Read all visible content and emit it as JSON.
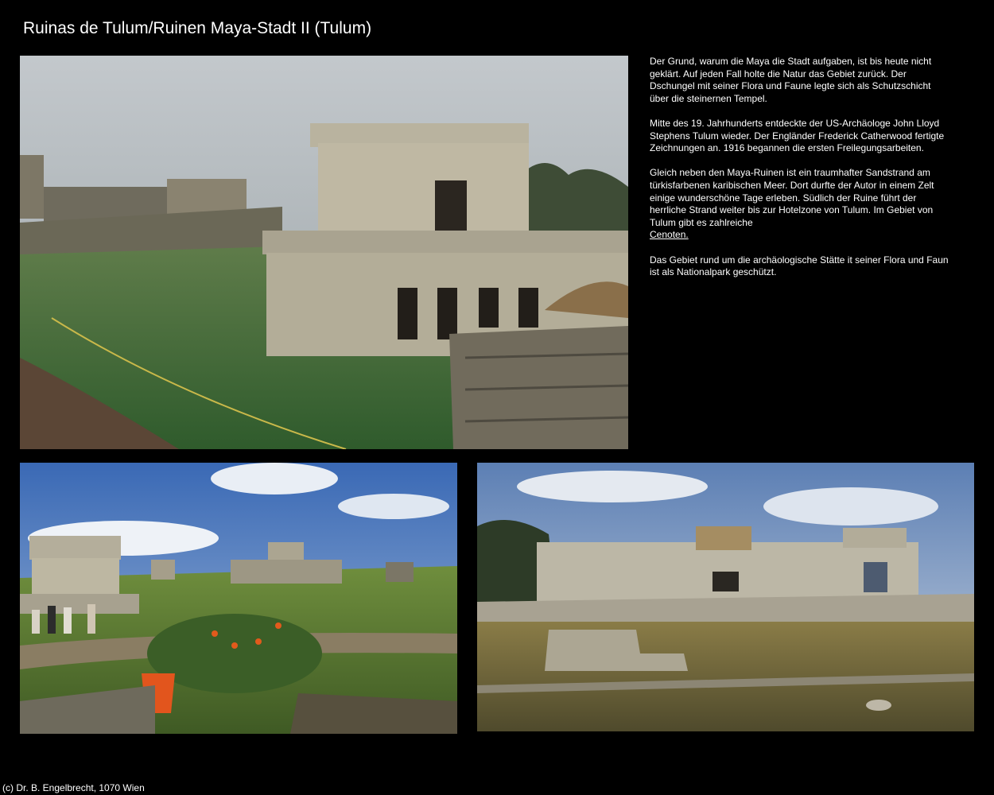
{
  "page": {
    "title": "Ruinas de Tulum/Ruinen Maya-Stadt II (Tulum)",
    "footer": "(c) Dr. B. Engelbrecht, 1070 Wien"
  },
  "text": {
    "p1": "Der Grund, warum die Maya die Stadt aufgaben, ist bis heute nicht geklärt. Auf jeden Fall holte die Natur das Gebiet zurück. Der Dschungel mit seiner Flora und Faune legte sich als Schutzschicht über die steinernen Tempel.",
    "p2": "Mitte des 19. Jahrhunderts entdeckte der US-Archäologe John Lloyd Stephens Tulum wieder. Der Engländer Frederick Catherwood fertigte Zeichnungen an. 1916 begannen die ersten Freilegungsarbeiten.",
    "p3": "Gleich neben den Maya-Ruinen ist ein traumhafter Sandstrand am türkisfarbenen karibischen Meer. Dort durfte der Autor in einem Zelt einige wunderschöne Tage erleben. Südlich der Ruine führt der herrliche Strand weiter bis zur Hotelzone von Tulum. Im Gebiet von Tulum gibt es zahlreiche",
    "p3_link": "Cenoten.",
    "p4": "Das Gebiet rund um die archäologische Stätte it seiner Flora und Faun ist als Nationalpark geschützt."
  },
  "photos": {
    "main": "temple-ruin-photo",
    "left": "ruins-overview-photo",
    "right": "palace-ruin-photo"
  },
  "colors": {
    "background": "#000000",
    "text": "#ffffff"
  }
}
